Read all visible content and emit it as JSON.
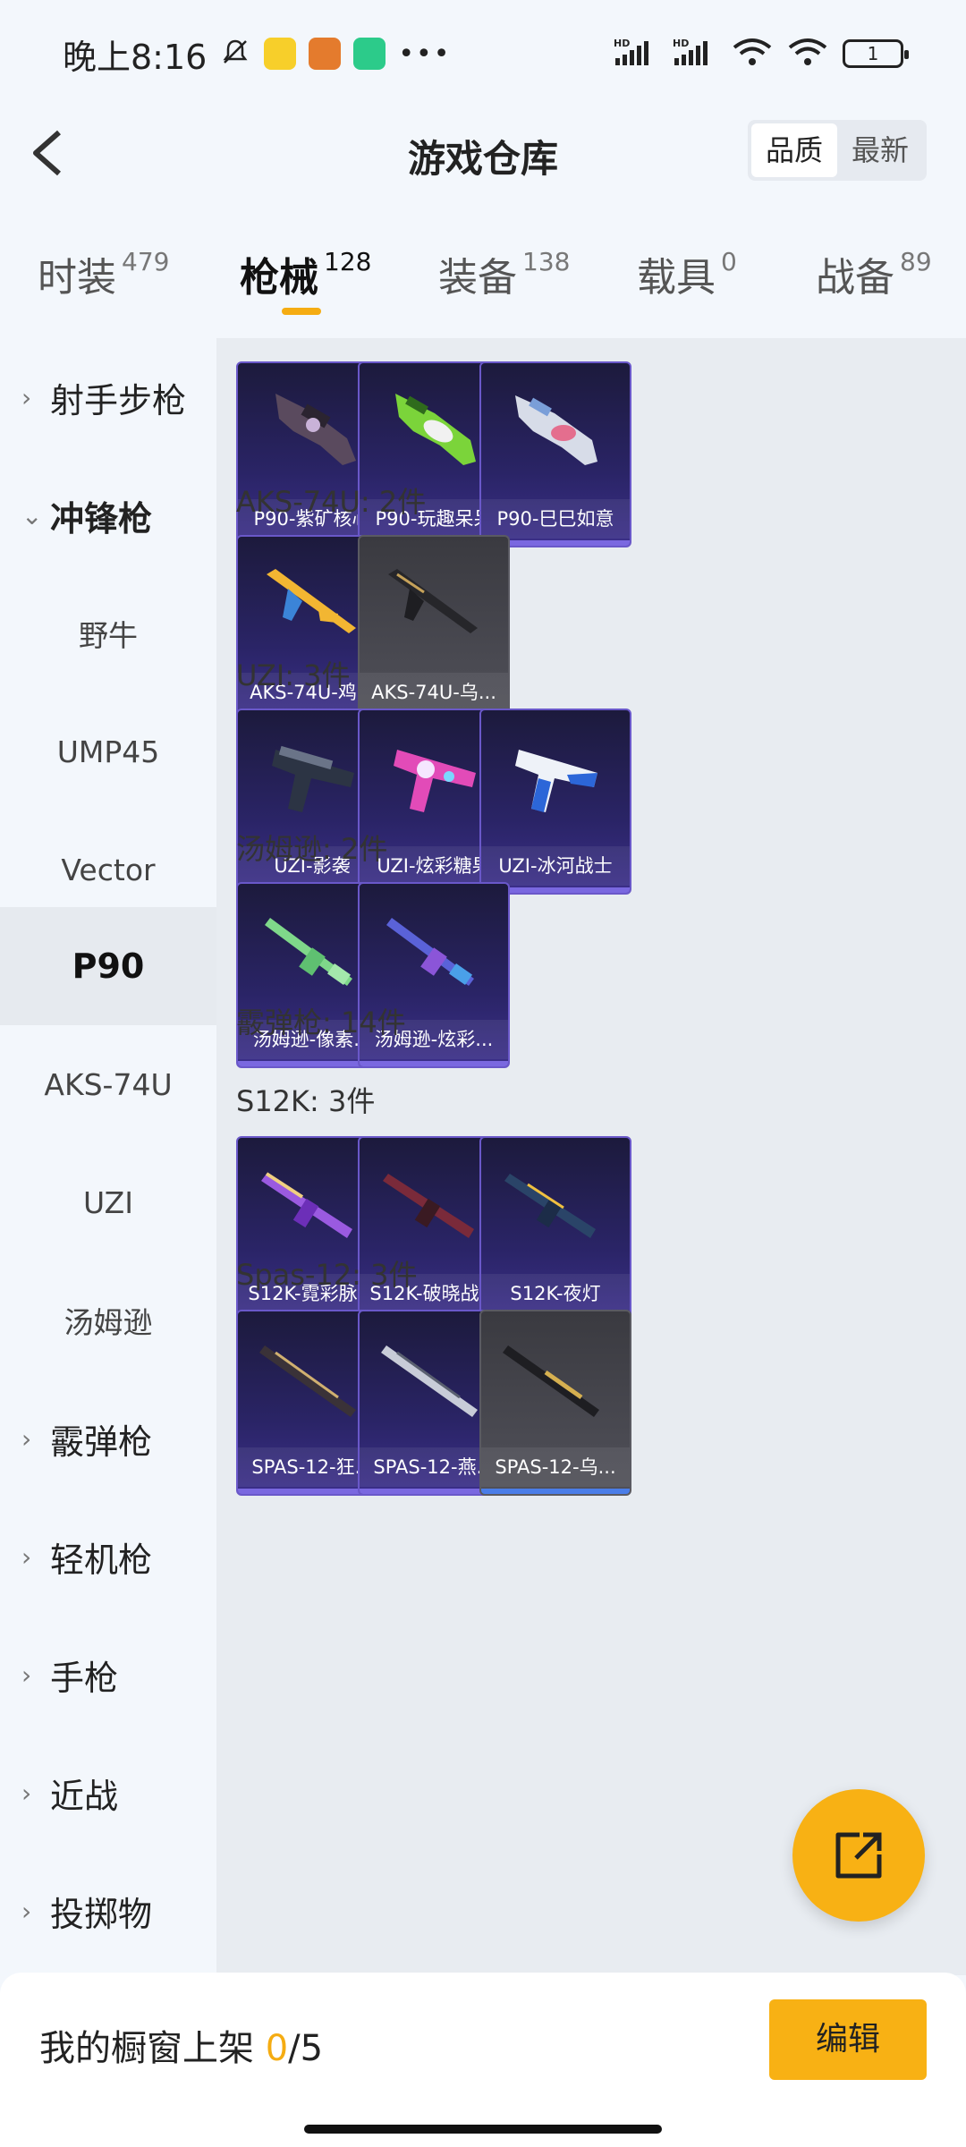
{
  "status": {
    "time": "晚上8:16",
    "battery": "1"
  },
  "header": {
    "title": "游戏仓库",
    "sort_quality": "品质",
    "sort_newest": "最新"
  },
  "tabs": [
    {
      "label": "时装",
      "count": "479"
    },
    {
      "label": "枪械",
      "count": "128"
    },
    {
      "label": "装备",
      "count": "138"
    },
    {
      "label": "载具",
      "count": "0"
    },
    {
      "label": "战备",
      "count": "89"
    }
  ],
  "sidebar": {
    "assault_rifle": "射手步枪",
    "smg": "冲锋枪",
    "sub": [
      "野牛",
      "UMP45",
      "Vector",
      "P90",
      "AKS-74U",
      "UZI",
      "汤姆逊"
    ],
    "shotgun": "霰弹枪",
    "lmg": "轻机枪",
    "pistol": "手枪",
    "melee": "近战",
    "throwable": "投掷物"
  },
  "content": {
    "p90_items": [
      "P90-紫矿核心",
      "P90-玩趣呆呆",
      "P90-巳巳如意"
    ],
    "aks_title": "AKS-74U: 2件",
    "aks_items": [
      "AKS-74U-鸡...",
      "AKS-74U-乌..."
    ],
    "uzi_title": "UZI: 3件",
    "uzi_items": [
      "UZI-影袭",
      "UZI-炫彩糖果",
      "UZI-冰河战士"
    ],
    "tommy_title": "汤姆逊: 2件",
    "tommy_items": [
      "汤姆逊-像素...",
      "汤姆逊-炫彩..."
    ],
    "shotgun_title": "霰弹枪: 14件",
    "s12k_title": "S12K: 3件",
    "s12k_items": [
      "S12K-霓彩脉冲",
      "S12K-破晓战魂",
      "S12K-夜灯"
    ],
    "spas_title": "Spas-12: 3件",
    "spas_items": [
      "SPAS-12-狂...",
      "SPAS-12-燕...",
      "SPAS-12-乌..."
    ]
  },
  "bottom": {
    "showcase_label": "我的橱窗上架 ",
    "showcase_count": "0",
    "showcase_total": "/5",
    "edit": "编辑"
  },
  "colors": {
    "accent": "#f8b114",
    "card_purple": "#2a2466",
    "card_gray": "#4a4a52"
  }
}
